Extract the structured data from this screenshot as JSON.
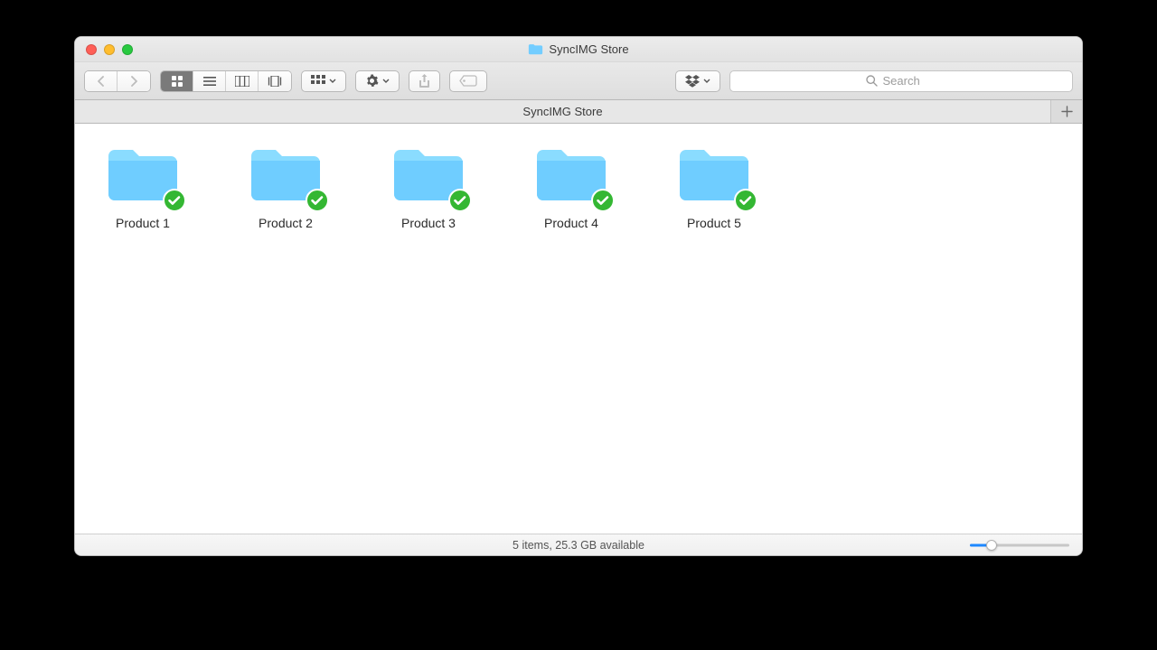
{
  "window": {
    "title": "SyncIMG Store"
  },
  "tabs": [
    {
      "label": "SyncIMG Store"
    }
  ],
  "search": {
    "placeholder": "Search"
  },
  "items": [
    {
      "label": "Product 1"
    },
    {
      "label": "Product 2"
    },
    {
      "label": "Product 3"
    },
    {
      "label": "Product 4"
    },
    {
      "label": "Product 5"
    }
  ],
  "status": {
    "text": "5 items, 25.3 GB available"
  }
}
